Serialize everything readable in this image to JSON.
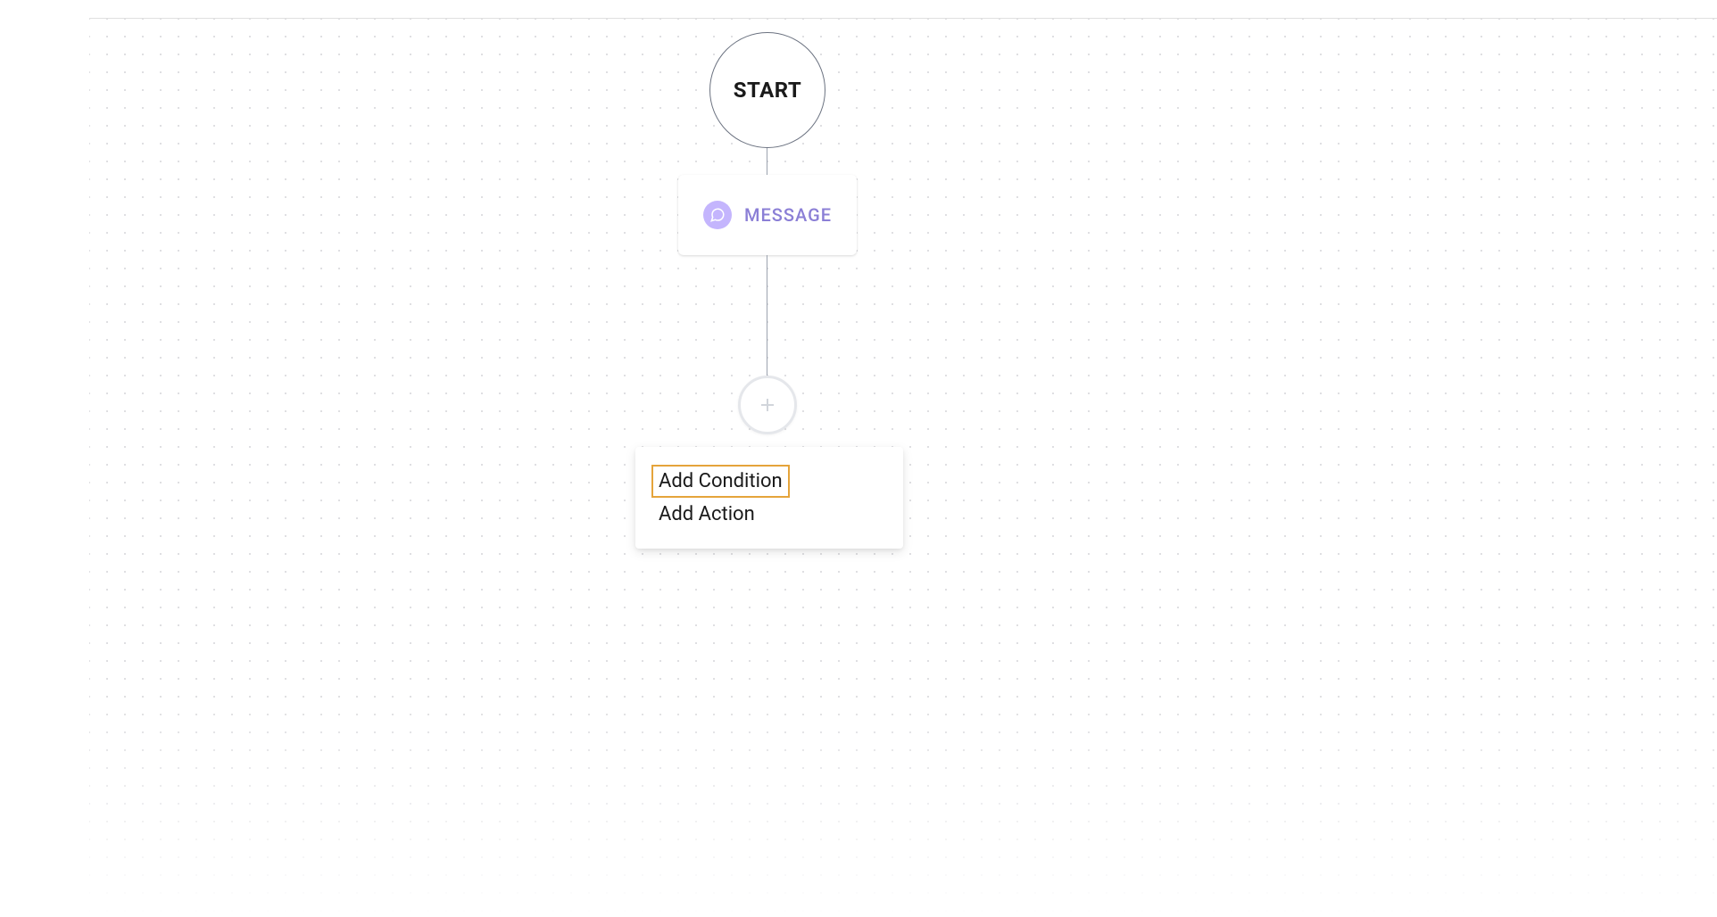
{
  "flow": {
    "start_label": "START",
    "message_node": {
      "label": "MESSAGE",
      "icon": "chat-icon"
    },
    "add_button": {
      "icon": "plus-icon"
    },
    "dropdown": {
      "items": [
        {
          "label": "Add Condition",
          "highlighted": true
        },
        {
          "label": "Add Action",
          "highlighted": false
        }
      ]
    }
  },
  "colors": {
    "accent_purple": "#8b7fd6",
    "icon_purple_bg": "#c4b5fd",
    "highlight_orange": "#e5a43b",
    "node_border": "#6b7280",
    "connector": "#9ca3af"
  }
}
